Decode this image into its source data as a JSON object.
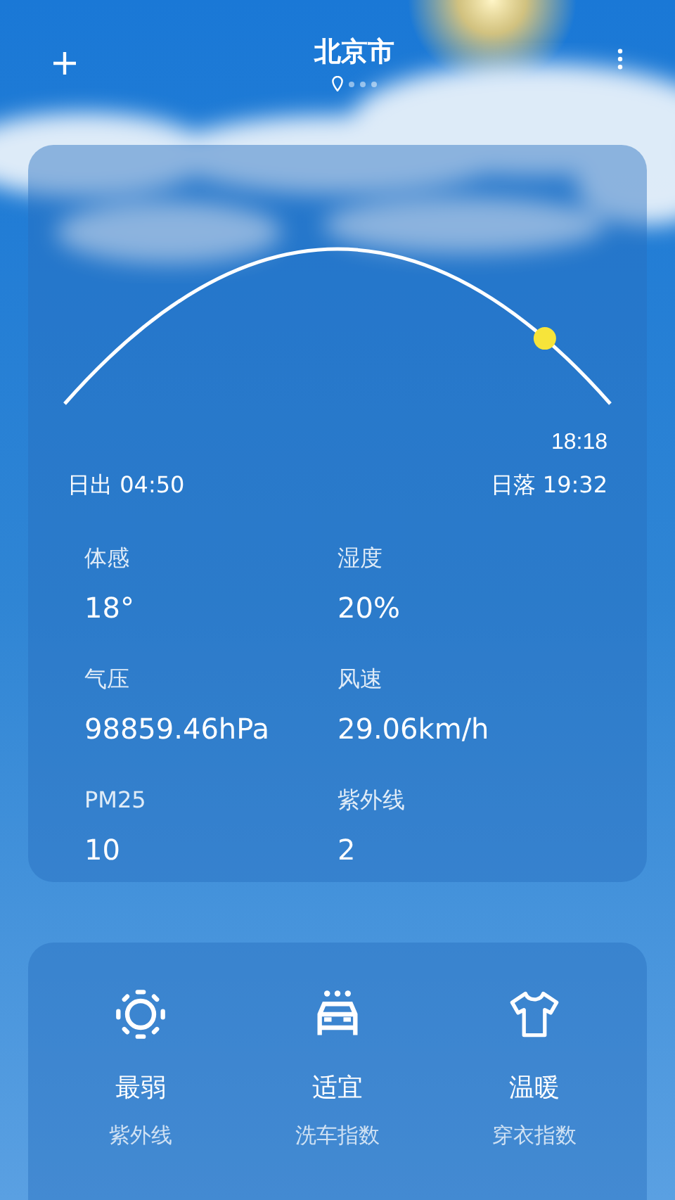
{
  "header": {
    "city": "北京市",
    "pages": [
      {
        "kind": "location",
        "selected": true
      },
      {
        "kind": "dot",
        "selected": false
      },
      {
        "kind": "dot",
        "selected": false
      },
      {
        "kind": "dot",
        "selected": false
      }
    ]
  },
  "sun": {
    "now": "18:18",
    "level": 0.88,
    "sunrise": "日出 04:50",
    "sunset": "日落 19:32"
  },
  "stats": [
    {
      "label": "体感",
      "value": "18°"
    },
    {
      "label": "湿度",
      "value": "20%"
    },
    {
      "label": "气压",
      "value": "98859.46hPa"
    },
    {
      "label": "风速",
      "value": "29.06km/h"
    },
    {
      "label": "PM25",
      "value": "10"
    },
    {
      "label": "紫外线",
      "value": "2"
    }
  ],
  "indices": [
    {
      "kind": "uv",
      "value": "最弱",
      "label": "紫外线"
    },
    {
      "kind": "carwash",
      "value": "适宜",
      "label": "洗车指数"
    },
    {
      "kind": "clothing",
      "value": "温暖",
      "label": "穿衣指数"
    }
  ]
}
